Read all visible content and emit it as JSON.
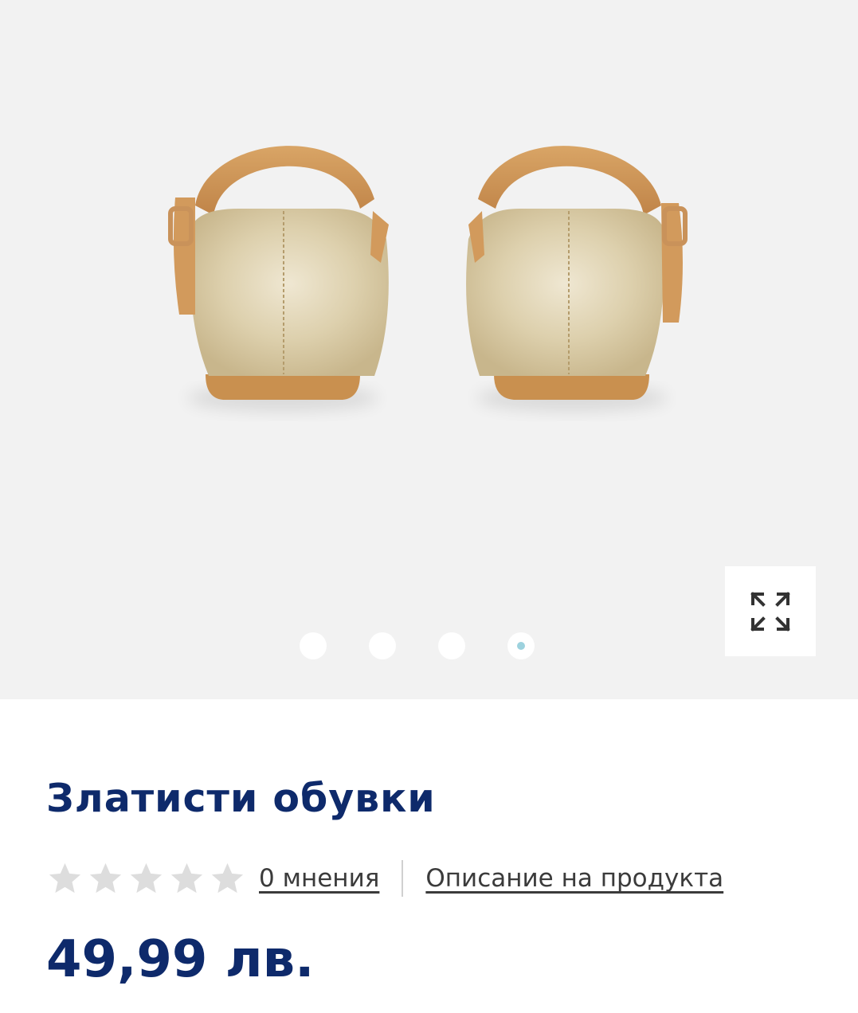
{
  "product": {
    "title": "Златисти обувки",
    "price": "49,99 лв.",
    "rating_value": 0,
    "rating_max": 5,
    "reviews_link": "0 мнения",
    "description_link": "Описание на продукта"
  },
  "gallery": {
    "image_count": 4,
    "active_index": 4,
    "expand_icon": "expand-arrows-icon",
    "photo_subject": "gold-ballerina-shoes-back-view"
  },
  "colors": {
    "brand_navy": "#0e2a6b",
    "gallery_bg": "#f2f2f2",
    "active_dot": "#9dd2de",
    "star_empty": "#dddddd"
  }
}
